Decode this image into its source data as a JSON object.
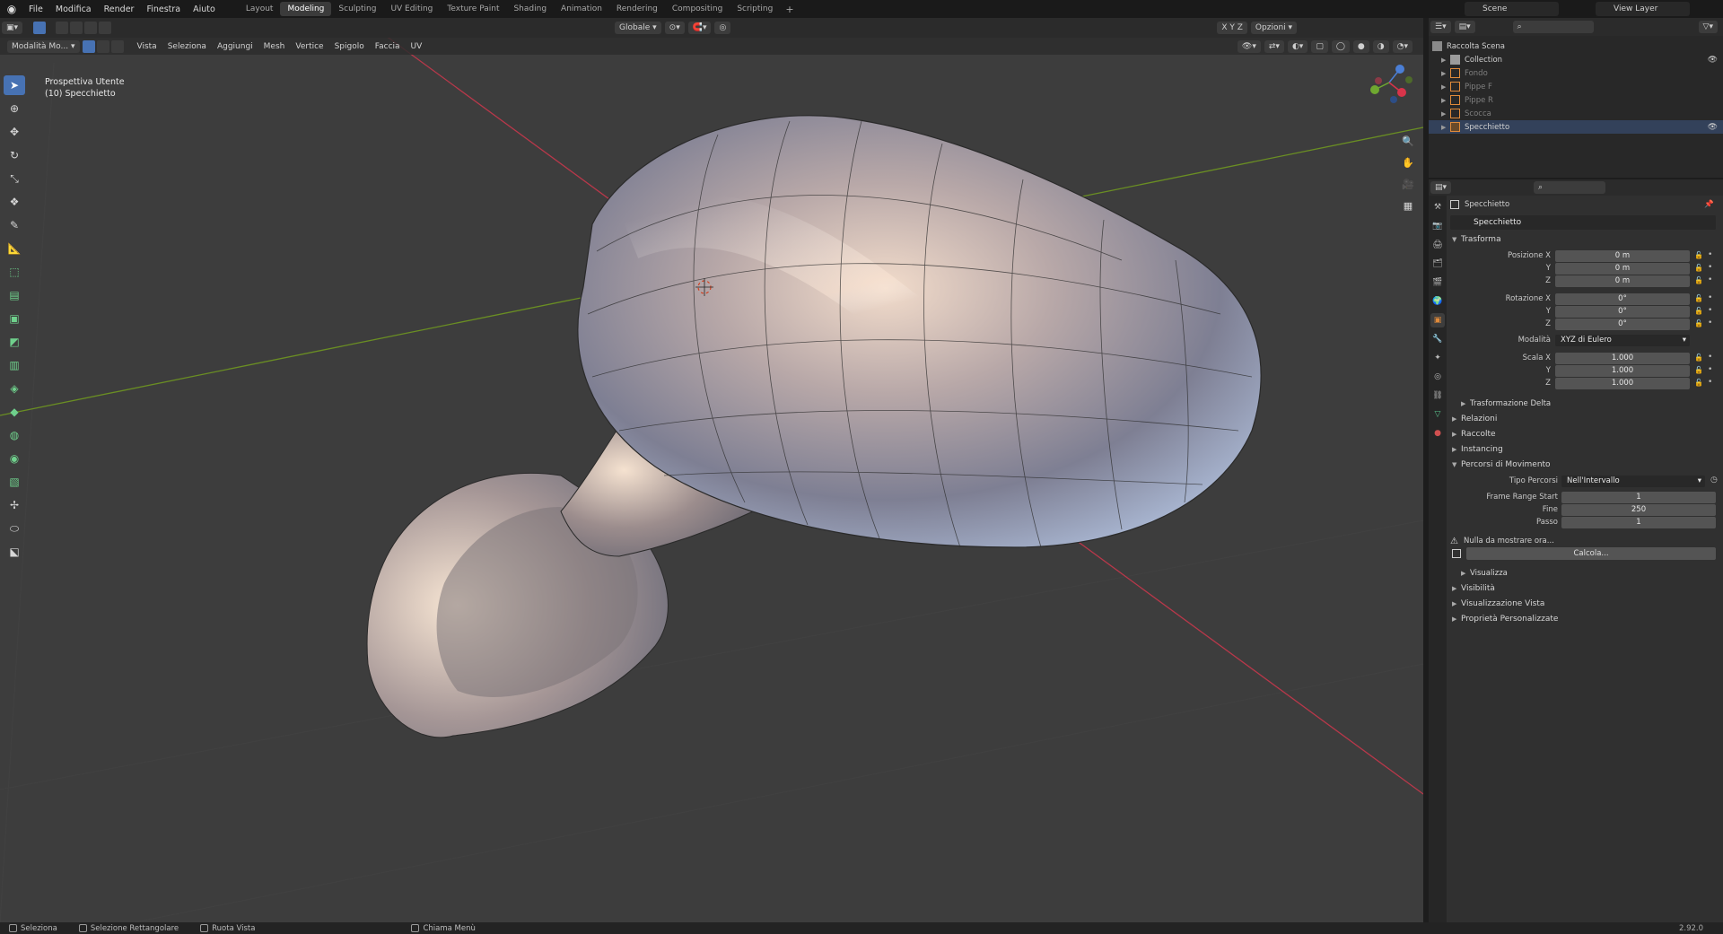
{
  "topbar": {
    "menu": [
      "File",
      "Modifica",
      "Render",
      "Finestra",
      "Aiuto"
    ],
    "workspaces": [
      "Layout",
      "Modeling",
      "Sculpting",
      "UV Editing",
      "Texture Paint",
      "Shading",
      "Animation",
      "Rendering",
      "Compositing",
      "Scripting"
    ],
    "active_workspace": "Modeling",
    "scene": "Scene",
    "view_layer": "View Layer"
  },
  "viewport": {
    "mode": "Modalità Mo...",
    "menus": [
      "Vista",
      "Seleziona",
      "Aggiungi",
      "Mesh",
      "Vertice",
      "Spigolo",
      "Faccia",
      "UV"
    ],
    "orientation": "Globale",
    "options_label": "Opzioni",
    "axes_labels": [
      "X",
      "Y",
      "Z"
    ],
    "overlay_line1": "Prospettiva Utente",
    "overlay_line2": "(10) Specchietto"
  },
  "outliner": {
    "root": "Raccolta Scena",
    "items": [
      {
        "label": "Collection",
        "dim": false,
        "selected": false
      },
      {
        "label": "Fondo",
        "dim": true,
        "selected": false
      },
      {
        "label": "Pippe F",
        "dim": true,
        "selected": false
      },
      {
        "label": "Pippe R",
        "dim": true,
        "selected": false
      },
      {
        "label": "Scocca",
        "dim": true,
        "selected": false
      },
      {
        "label": "Specchietto",
        "dim": false,
        "selected": true
      }
    ]
  },
  "properties": {
    "object_title": "Specchietto",
    "object_name": "Specchietto",
    "transform_panel": "Trasforma",
    "position_label": "Posizione X",
    "rotation_label": "Rotazione X",
    "scale_label": "Scala X",
    "y_label": "Y",
    "z_label": "Z",
    "position": [
      "0 m",
      "0 m",
      "0 m"
    ],
    "rotation": [
      "0°",
      "0°",
      "0°"
    ],
    "mode_label": "Modalità",
    "rotation_mode": "XYZ di Eulero",
    "scale": [
      "1.000",
      "1.000",
      "1.000"
    ],
    "delta_panel": "Trasformazione Delta",
    "collapsed_panels": [
      "Relazioni",
      "Raccolte",
      "Instancing"
    ],
    "motion_panel": "Percorsi di Movimento",
    "path_type_label": "Tipo Percorsi",
    "path_type": "Nell'Intervallo",
    "frame_start_label": "Frame Range Start",
    "frame_start": "1",
    "end_label": "Fine",
    "end": "250",
    "step_label": "Passo",
    "step": "1",
    "warning": "Nulla da mostrare ora...",
    "calc_button": "Calcola...",
    "visualize_panel": "Visualizza",
    "bottom_panels": [
      "Visibilità",
      "Visualizzazione Vista",
      "Proprietà Personalizzate"
    ]
  },
  "statusbar": {
    "items": [
      "Seleziona",
      "Selezione Rettangolare",
      "Ruota Vista",
      "Chiama Menù"
    ],
    "version": "2.92.0"
  },
  "colors": {
    "accent": "#4772b3",
    "x_axis": "#b8384a",
    "y_axis": "#6a8e23",
    "object_orange": "#e08a3a"
  }
}
